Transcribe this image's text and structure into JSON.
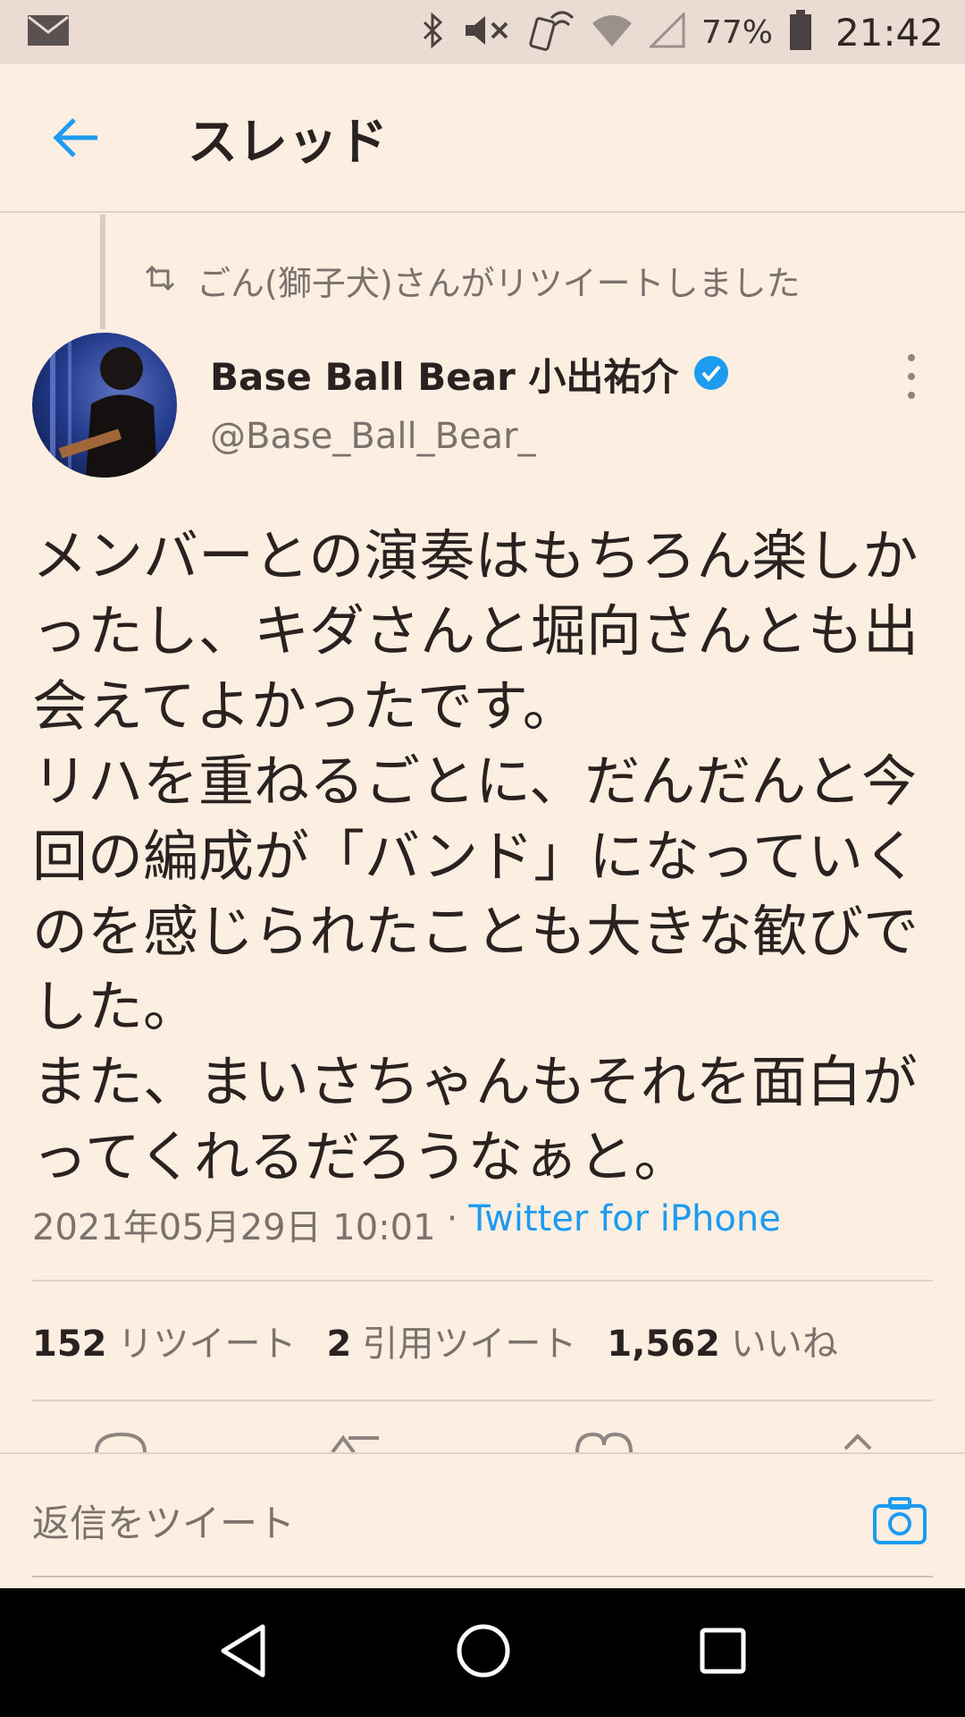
{
  "status_bar": {
    "battery": "77%",
    "time": "21:42",
    "icons": [
      "mail-icon",
      "bluetooth-icon",
      "mute-icon",
      "nfc-icon",
      "wifi-icon",
      "signal-icon",
      "battery-icon"
    ]
  },
  "header": {
    "title": "スレッド",
    "back_icon": "back-arrow-icon"
  },
  "retweet_banner": {
    "text": "ごん(獅子犬)さんがリツイートしました"
  },
  "tweet": {
    "display_name": "Base Ball Bear 小出祐介",
    "handle": "@Base_Ball_Bear_",
    "verified": true,
    "text": "メンバーとの演奏はもちろん楽しかったし、キダさんと堀向さんとも出会えてよかったです。\nリハを重ねるごとに、だんだんと今回の編成が「バンド」になっていくのを感じられたことも大きな歓びでした。\nまた、まいさちゃんもそれを面白がってくれるだろうなぁと。",
    "timestamp": "2021年05月29日 10:01",
    "separator": "·",
    "source": "Twitter for iPhone"
  },
  "stats": {
    "retweets_count": "152",
    "retweets_label": "リツイート",
    "quotes_count": "2",
    "quotes_label": "引用ツイート",
    "likes_count": "1,562",
    "likes_label": "いいね"
  },
  "reply": {
    "placeholder": "返信をツイート"
  },
  "colors": {
    "background": "#fdeee2",
    "accent": "#1d9bf0",
    "status_bar": "#eadcd2"
  }
}
